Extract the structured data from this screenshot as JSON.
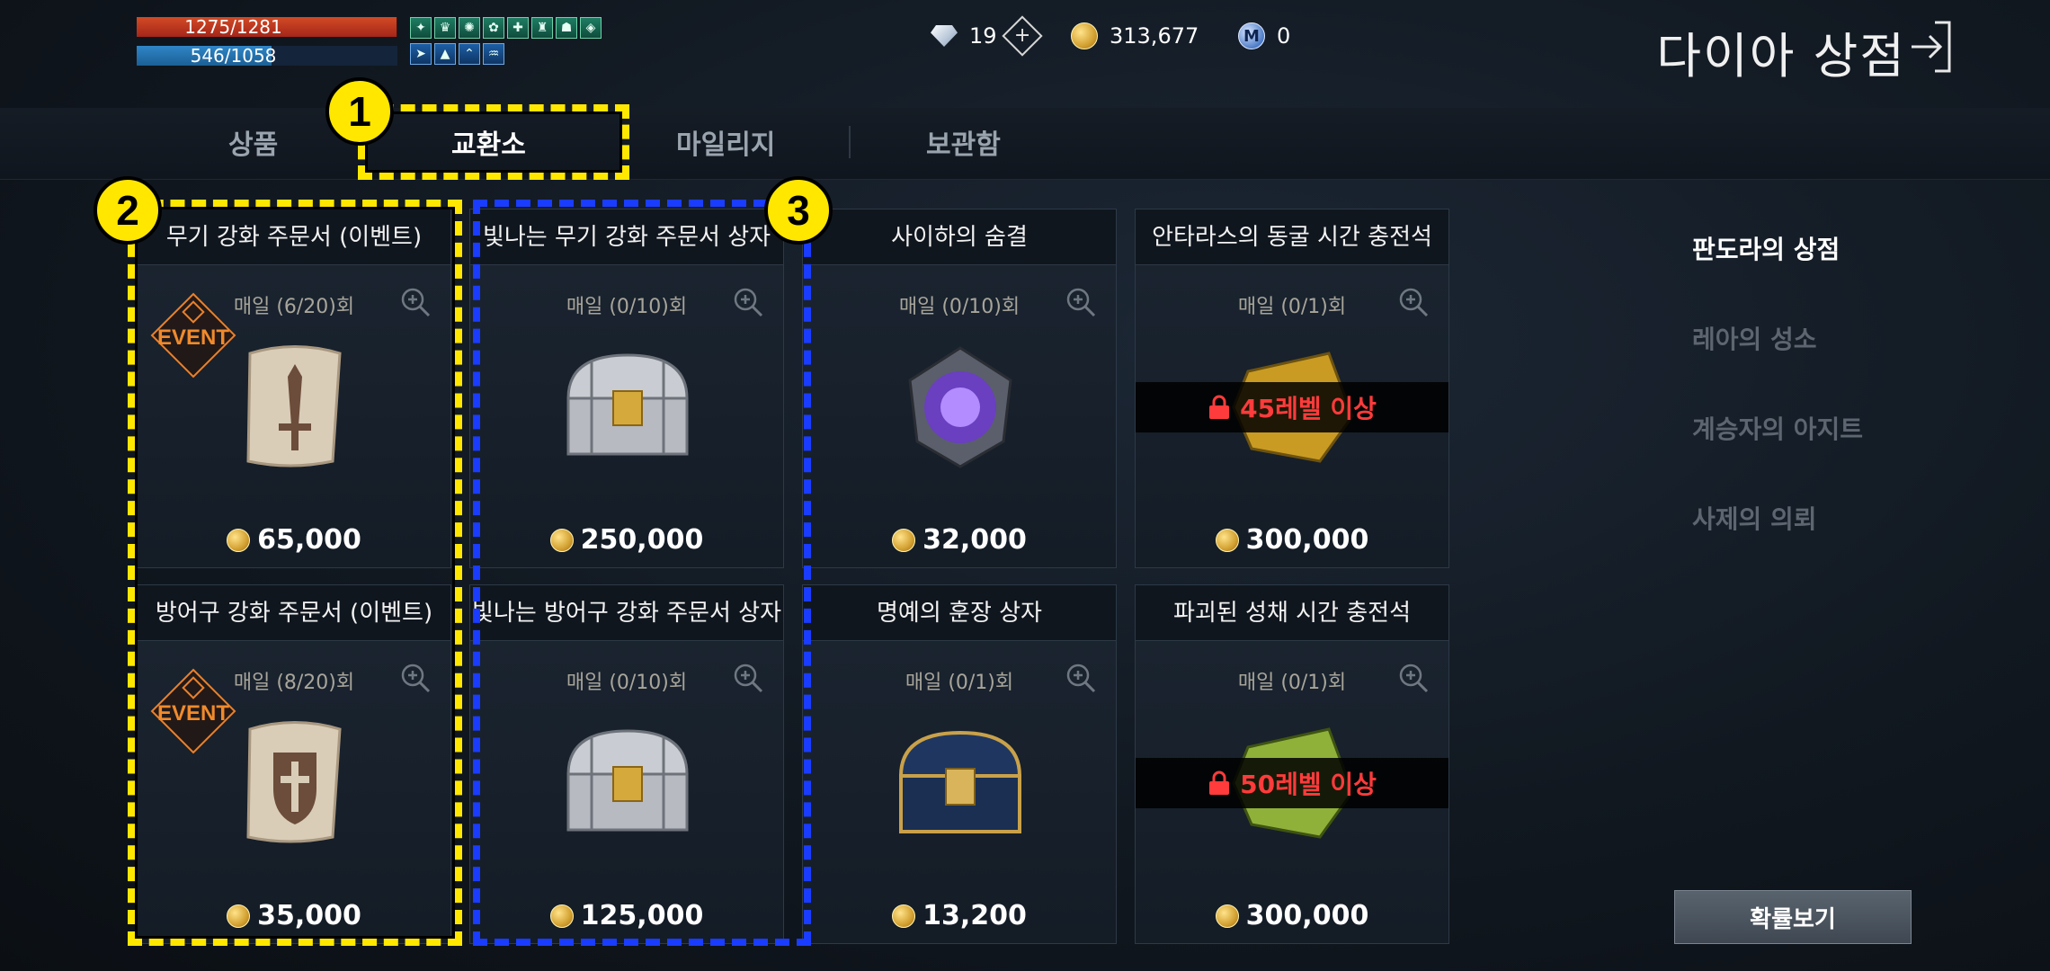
{
  "status": {
    "hp": {
      "text": "1275/1281",
      "value": 1275,
      "max": 1281
    },
    "mp": {
      "text": "546/1058",
      "value": 546,
      "max": 1058
    },
    "buff_icons_row1": [
      "buff-icon",
      "buff-icon",
      "buff-icon",
      "buff-icon",
      "buff-icon",
      "buff-icon",
      "buff-icon",
      "buff-icon"
    ],
    "buff_icons_row2": [
      "buff-icon",
      "buff-icon",
      "buff-icon",
      "buff-icon"
    ]
  },
  "currency": {
    "diamond": "19",
    "gold": "313,677",
    "mileage": "0"
  },
  "header": {
    "title": "다이아 상점"
  },
  "tabs": [
    {
      "label": "상품",
      "active": false
    },
    {
      "label": "교환소",
      "active": true
    },
    {
      "label": "마일리지",
      "active": false
    },
    {
      "label": "보관함",
      "active": false
    }
  ],
  "items": [
    {
      "name": "무기 강화 주문서 (이벤트)",
      "limit": "매일 (6/20)회",
      "price": "65,000",
      "badge": "EVENT",
      "art": "weapon-scroll"
    },
    {
      "name": "빛나는 무기 강화 주문서 상자",
      "limit": "매일 (0/10)회",
      "price": "250,000",
      "art": "silver-chest"
    },
    {
      "name": "사이하의 숨결",
      "limit": "매일 (0/10)회",
      "price": "32,000",
      "art": "purple-gem"
    },
    {
      "name": "안타라스의 동굴 시간 충전석",
      "limit": "매일 (0/1)회",
      "price": "300,000",
      "lock": "45레벨 이상",
      "art": "gold-stone"
    },
    {
      "name": "방어구 강화 주문서 (이벤트)",
      "limit": "매일 (8/20)회",
      "price": "35,000",
      "badge": "EVENT",
      "art": "armor-scroll"
    },
    {
      "name": "빛나는 방어구 강화 주문서 상자",
      "limit": "매일 (0/10)회",
      "price": "125,000",
      "art": "silver-chest"
    },
    {
      "name": "명예의 훈장 상자",
      "limit": "매일 (0/1)회",
      "price": "13,200",
      "art": "blue-chest"
    },
    {
      "name": "파괴된 성채 시간 충전석",
      "limit": "매일 (0/1)회",
      "price": "300,000",
      "lock": "50레벨 이상",
      "art": "green-stone"
    }
  ],
  "markers": [
    "1",
    "2",
    "3"
  ],
  "sidebar": [
    {
      "label": "판도라의 상점",
      "active": true
    },
    {
      "label": "레아의 성소",
      "active": false
    },
    {
      "label": "계승자의 아지트",
      "active": false
    },
    {
      "label": "사제의 의뢰",
      "active": false
    }
  ],
  "prob_button": "확률보기",
  "colors": {
    "hp": "#c23a20",
    "mp": "#2677b5",
    "highlight_yellow": "#ffe700",
    "highlight_blue": "#1a3cff",
    "lock_red": "#ff3b3b"
  }
}
